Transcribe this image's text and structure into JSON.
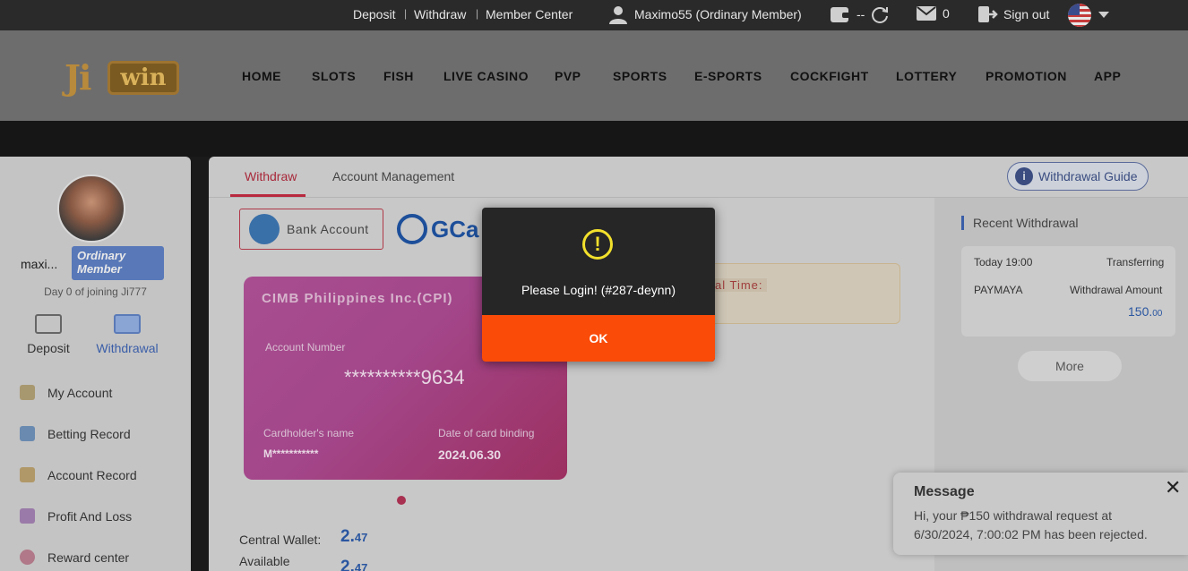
{
  "topbar": {
    "deposit": "Deposit",
    "withdraw": "Withdraw",
    "member_center": "Member Center",
    "username": "Maximo55 (Ordinary Member)",
    "wallet_value": "--",
    "mail_count": "0",
    "sign_out": "Sign out",
    "sep": "|"
  },
  "nav": [
    "HOME",
    "SLOTS",
    "FISH",
    "LIVE CASINO",
    "PVP",
    "SPORTS",
    "E-SPORTS",
    "COCKFIGHT",
    "LOTTERY",
    "PROMOTION",
    "APP"
  ],
  "logo": {
    "part1": "Ji",
    "part2": "win"
  },
  "sidebar": {
    "username": "maxi...",
    "badge": "Ordinary Member",
    "day_text": "Day 0 of joining Ji777",
    "quick": {
      "deposit": "Deposit",
      "withdrawal": "Withdrawal"
    },
    "menu": [
      "My Account",
      "Betting Record",
      "Account Record",
      "Profit And Loss",
      "Reward center"
    ]
  },
  "main": {
    "tabs": [
      "Withdraw",
      "Account Management"
    ],
    "guide": "Withdrawal Guide",
    "bank_account": "Bank Account",
    "gcash": "GCa",
    "card": {
      "bank": "CIMB Philippines Inc.(CPI)",
      "account_label": "Account Number",
      "account_number": "**********9634",
      "holder_label": "Cardholder's name",
      "holder": "M***********",
      "binding_label": "Date of card binding",
      "binding_date": "2024.06.30"
    },
    "central_wallet_label": "Central Wallet:",
    "central_wallet_int": "2.",
    "central_wallet_dec": "47",
    "available_label": "Available",
    "available_int": "2.",
    "available_dec": "47",
    "partial_time": "al Time:"
  },
  "recent": {
    "title": "Recent Withdrawal",
    "time": "Today 19:00",
    "status": "Transferring",
    "method": "PAYMAYA",
    "amount_label": "Withdrawal Amount",
    "amount_int": "150.",
    "amount_dec": "00",
    "more": "More"
  },
  "modal": {
    "icon": "!",
    "message": "Please Login! (#287-deynn)",
    "ok": "OK"
  },
  "toast": {
    "title": "Message",
    "body": "Hi, your ₱150 withdrawal request at 6/30/2024, 7:00:02 PM has been rejected.",
    "close": "✕"
  },
  "colors": {
    "accent": "#fa4b08",
    "warn": "#f2e02c",
    "link": "#2a56a0",
    "active_tab": "#b8283e"
  }
}
